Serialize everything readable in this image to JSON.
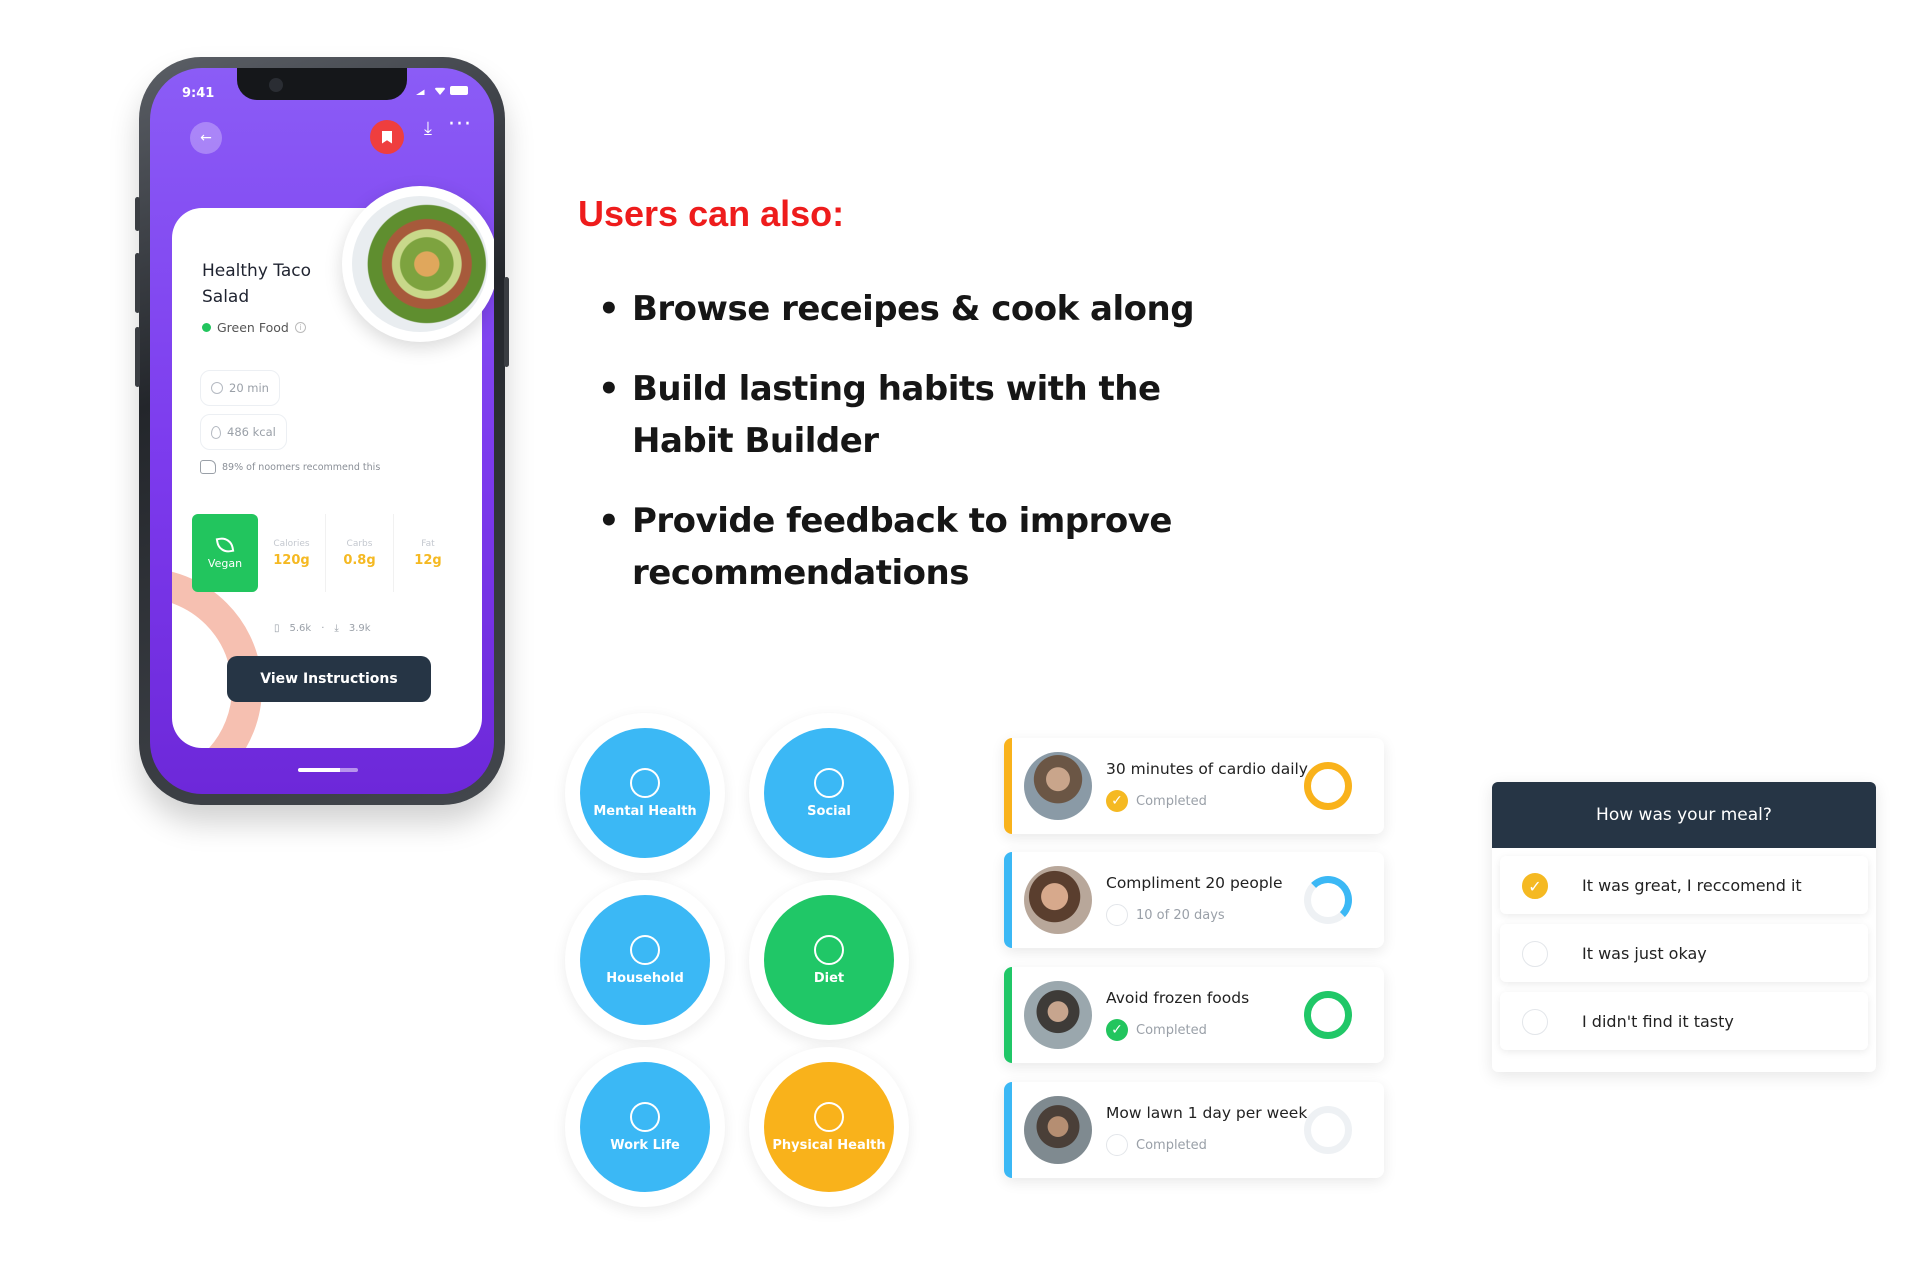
{
  "phone": {
    "status_time": "9:41",
    "dish_title": "Healthy Taco Salad",
    "dish_tag": "Green Food",
    "time_pill": "20 min",
    "kcal_pill": "486 kcal",
    "recommend_text": "89% of noomers recommend this",
    "vegan_label": "Vegan",
    "macros": [
      {
        "label": "Calories",
        "value": "120g"
      },
      {
        "label": "Carbs",
        "value": "0.8g"
      },
      {
        "label": "Fat",
        "value": "12g"
      }
    ],
    "saves": "5.6k",
    "downloads": "3.9k",
    "view_button": "View Instructions",
    "icons": [
      "arrow-left-icon",
      "bookmark-icon",
      "download-icon",
      "more-icon",
      "clock-icon",
      "flame-icon",
      "thumbs-up-icon",
      "leaf-icon"
    ]
  },
  "heading": "Users can also:",
  "bullets": [
    "Browse receipes & cook along",
    "Build lasting habits with the Habit Builder",
    "Provide feedback to improve recommendations"
  ],
  "categories": [
    {
      "label": "Mental Health",
      "color": "#3bb8f5",
      "icon": "brain-icon"
    },
    {
      "label": "Social",
      "color": "#3bb8f5",
      "icon": "people-icon"
    },
    {
      "label": "Household",
      "color": "#3bb8f5",
      "icon": "plunger-icon"
    },
    {
      "label": "Diet",
      "color": "#20c767",
      "icon": "broccoli-icon"
    },
    {
      "label": "Work Life",
      "color": "#3bb8f5",
      "icon": "briefcase-icon"
    },
    {
      "label": "Physical Health",
      "color": "#f9b21b",
      "icon": "muscle-icon"
    }
  ],
  "habits": [
    {
      "title": "30 minutes of cardio daily",
      "status": "Completed",
      "accent": "#f9b21b",
      "progress": 1.0
    },
    {
      "title": "Compliment 20 people",
      "status": "10 of 20 days",
      "accent": "#3bb8f5",
      "progress": 0.5
    },
    {
      "title": "Avoid frozen foods",
      "status": "Completed",
      "accent": "#20c767",
      "progress": 1.0
    },
    {
      "title": "Mow lawn 1 day per week",
      "status": "Completed",
      "accent": "#3bb8f5",
      "progress": 0.0
    }
  ],
  "survey": {
    "question": "How was your meal?",
    "options": [
      "It was great, I reccomend it",
      "It was just okay",
      "I didn't find it tasty"
    ],
    "selected_index": 0
  }
}
